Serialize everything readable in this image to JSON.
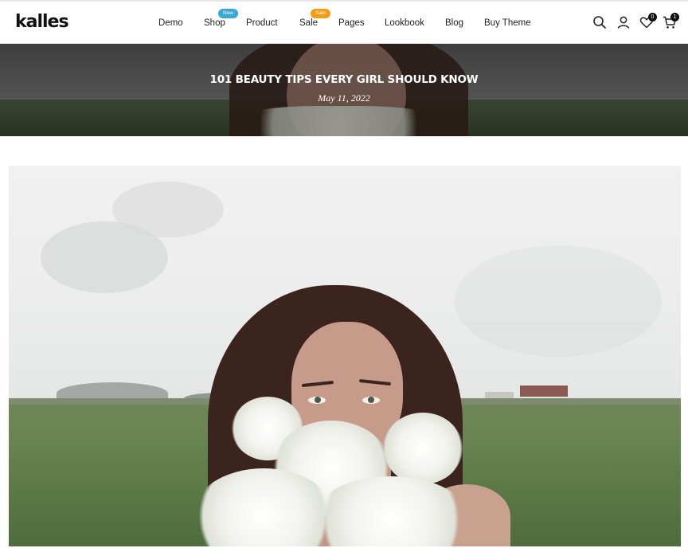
{
  "brand": {
    "logo_text": "kalles"
  },
  "nav": {
    "items": [
      {
        "label": "Demo",
        "badge": ""
      },
      {
        "label": "Shop",
        "badge": "New"
      },
      {
        "label": "Product",
        "badge": ""
      },
      {
        "label": "Sale",
        "badge": "Sale"
      },
      {
        "label": "Pages",
        "badge": ""
      },
      {
        "label": "Lookbook",
        "badge": ""
      },
      {
        "label": "Blog",
        "badge": ""
      },
      {
        "label": "Buy Theme",
        "badge": ""
      }
    ]
  },
  "header_icons": {
    "search": "search-icon",
    "account": "user-icon",
    "wishlist": {
      "icon": "heart-icon",
      "count": "0"
    },
    "cart": {
      "icon": "cart-icon",
      "count": "1"
    }
  },
  "hero": {
    "title": "101 BEAUTY TIPS EVERY GIRL SHOULD KNOW",
    "date": "May 11, 2022"
  },
  "colors": {
    "badge_new": "#3ba7d6",
    "badge_sale": "#f39c12",
    "text_dark": "#222222"
  }
}
